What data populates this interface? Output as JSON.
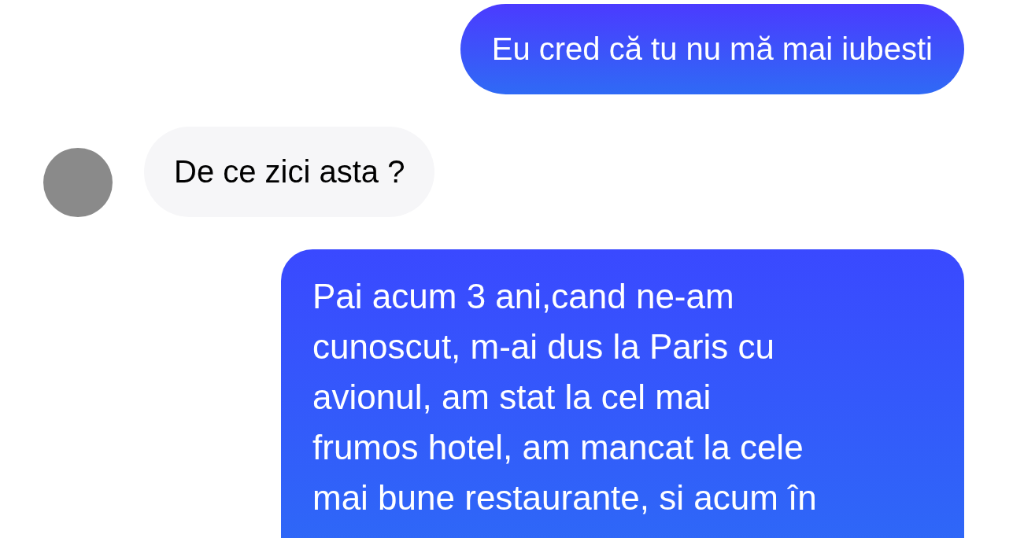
{
  "messages": [
    {
      "kind": "sent",
      "text": "Eu cred că tu nu mă mai iubesti"
    },
    {
      "kind": "received",
      "text": "De ce zici asta ?"
    },
    {
      "kind": "sent",
      "text": "Pai acum 3 ani,cand ne-am\ncunoscut, m-ai dus la Paris cu\navionul, am stat la cel mai\nfrumos hotel, am mancat la cele\nmai bune restaurante, si acum în"
    }
  ]
}
